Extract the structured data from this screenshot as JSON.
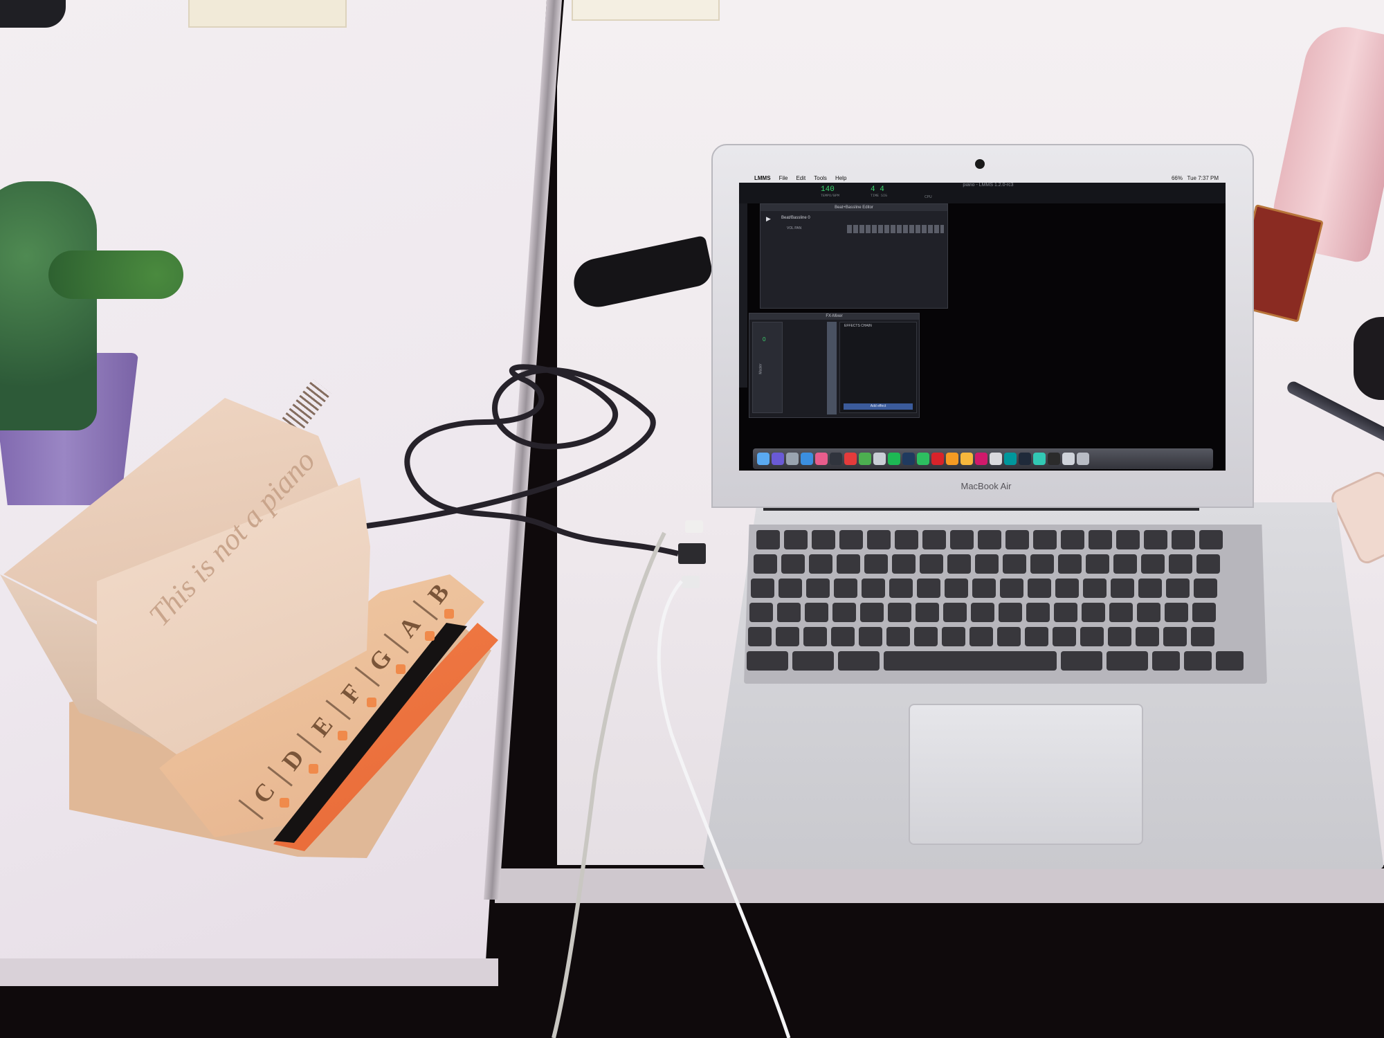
{
  "scene": {
    "wooden_device": {
      "engraved_text": "This is not a piano",
      "keys": [
        "C",
        "D",
        "E",
        "F",
        "G",
        "A",
        "B"
      ]
    },
    "laptop": {
      "brand_text": "MacBook Air",
      "screen": {
        "menubar": {
          "app": "LMMS",
          "menus": [
            "File",
            "Edit",
            "Tools",
            "Help"
          ],
          "clock": "Tue 7:37 PM",
          "battery": "66%"
        },
        "window_title": "piano - LMMS 1.2.0-rc3",
        "tempo_value": "140",
        "tempo_label": "TEMPO/BPM",
        "time_sig": "4 4",
        "time_sig_label": "TIME SIG",
        "cpu_label": "CPU",
        "beat_bassline_editor": {
          "title": "Beat+Bassline Editor",
          "track": "Beat/Bassline 0",
          "vol_pan": "VOL PAN"
        },
        "fx_mixer": {
          "title": "FX-Mixer",
          "channel_value": "0",
          "channel_name": "Master",
          "effects_chain_label": "EFFECTS CHAIN",
          "add_effect_label": "Add effect"
        },
        "dock_icons": [
          {
            "name": "finder-icon",
            "color": "#5aa9f0"
          },
          {
            "name": "siri-icon",
            "color": "#6a5ad6"
          },
          {
            "name": "launchpad-icon",
            "color": "#9aa4b0"
          },
          {
            "name": "safari-icon",
            "color": "#3b8fe0"
          },
          {
            "name": "itunes-icon",
            "color": "#e85d8c"
          },
          {
            "name": "quicktime-icon",
            "color": "#30343d"
          },
          {
            "name": "app-red-icon",
            "color": "#e43b3b"
          },
          {
            "name": "chrome-icon",
            "color": "#4caf50"
          },
          {
            "name": "preview-icon",
            "color": "#c9ced6"
          },
          {
            "name": "spotify-icon",
            "color": "#1db954"
          },
          {
            "name": "photoshop-icon",
            "color": "#1f3a5f"
          },
          {
            "name": "evernote-icon",
            "color": "#2dbe60"
          },
          {
            "name": "acrobat-icon",
            "color": "#d8232a"
          },
          {
            "name": "illustrator-icon",
            "color": "#f59b23"
          },
          {
            "name": "sketch-icon",
            "color": "#f6b73c"
          },
          {
            "name": "indesign-icon",
            "color": "#d0196b"
          },
          {
            "name": "keyboard-app-icon",
            "color": "#d9d9dd"
          },
          {
            "name": "arduino-icon",
            "color": "#00979c"
          },
          {
            "name": "lmms-icon",
            "color": "#1f2a3a"
          },
          {
            "name": "audio-app-icon",
            "color": "#32c8b4"
          },
          {
            "name": "terminal-icon",
            "color": "#2b2b2b"
          },
          {
            "name": "screen-icon",
            "color": "#cfd3da"
          },
          {
            "name": "trash-icon",
            "color": "#b8bcc4"
          }
        ]
      }
    }
  }
}
